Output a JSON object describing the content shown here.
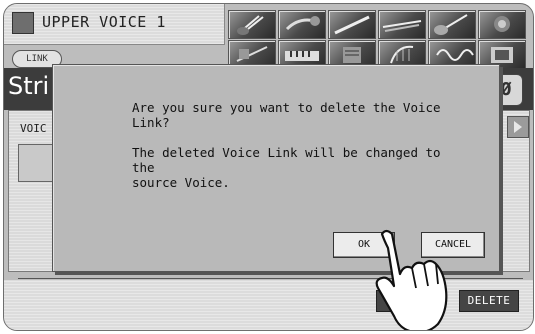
{
  "header": {
    "title": "UPPER VOICE 1"
  },
  "voice_categories": [
    {
      "icon": "strings-icon"
    },
    {
      "icon": "brass-icon"
    },
    {
      "icon": "woodwind-icon"
    },
    {
      "icon": "flute-icon"
    },
    {
      "icon": "guitar-icon"
    },
    {
      "icon": "choir-icon"
    },
    {
      "icon": "percussion-icon"
    },
    {
      "icon": "keyboard-icon"
    },
    {
      "icon": "organ-icon"
    },
    {
      "icon": "harp-icon"
    },
    {
      "icon": "synth-icon"
    },
    {
      "icon": "user-icon"
    }
  ],
  "link_badge": "LINK",
  "voice_name": "Stri",
  "section_label": "VOIC",
  "bottom": {
    "delete_label": "DELETE"
  },
  "dialog": {
    "message": "Are you sure you want to delete the Voice\nLink?\n\nThe deleted Voice Link will be changed to the\nsource Voice.",
    "ok_label": "OK",
    "cancel_label": "CANCEL"
  },
  "colors": {
    "screen_bg": "#bdbdbd",
    "dialog_bg": "#b9b9b9",
    "dark_button": "#454545"
  }
}
